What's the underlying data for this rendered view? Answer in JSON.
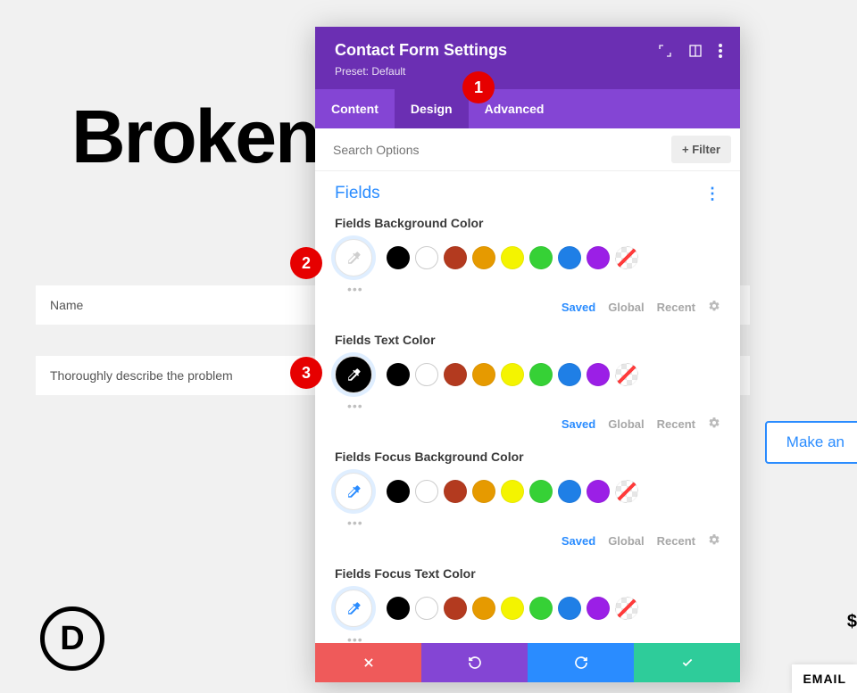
{
  "background": {
    "heading": "Broken                                  tact",
    "fields": [
      {
        "placeholder": "Name"
      },
      {
        "placeholder": "Thoroughly describe the problem"
      }
    ],
    "cta": "Make an",
    "logo_letter": "D",
    "email_badge": "EMAIL"
  },
  "annotations": [
    "1",
    "2",
    "3"
  ],
  "panel": {
    "title": "Contact Form Settings",
    "preset_label": "Preset: Default",
    "tabs": {
      "content": "Content",
      "design": "Design",
      "advanced": "Advanced"
    },
    "search_placeholder": "Search Options",
    "filter_label": "+  Filter",
    "section_title": "Fields",
    "chips": {
      "saved": "Saved",
      "global": "Global",
      "recent": "Recent"
    },
    "groups": [
      {
        "label": "Fields Background Color",
        "picker_style": "light",
        "picker_icon_color": "#cfcfcf"
      },
      {
        "label": "Fields Text Color",
        "picker_style": "black",
        "picker_icon_color": "#ffffff"
      },
      {
        "label": "Fields Focus Background Color",
        "picker_style": "light",
        "picker_icon_color": "#2a8cff"
      },
      {
        "label": "Fields Focus Text Color",
        "picker_style": "light",
        "picker_icon_color": "#2a8cff"
      }
    ],
    "palette": [
      "#000000",
      "white",
      "#b33a1f",
      "#e69a00",
      "#f4f400",
      "#36d136",
      "#1f7fe6",
      "#9b1fe6",
      "transp"
    ]
  }
}
